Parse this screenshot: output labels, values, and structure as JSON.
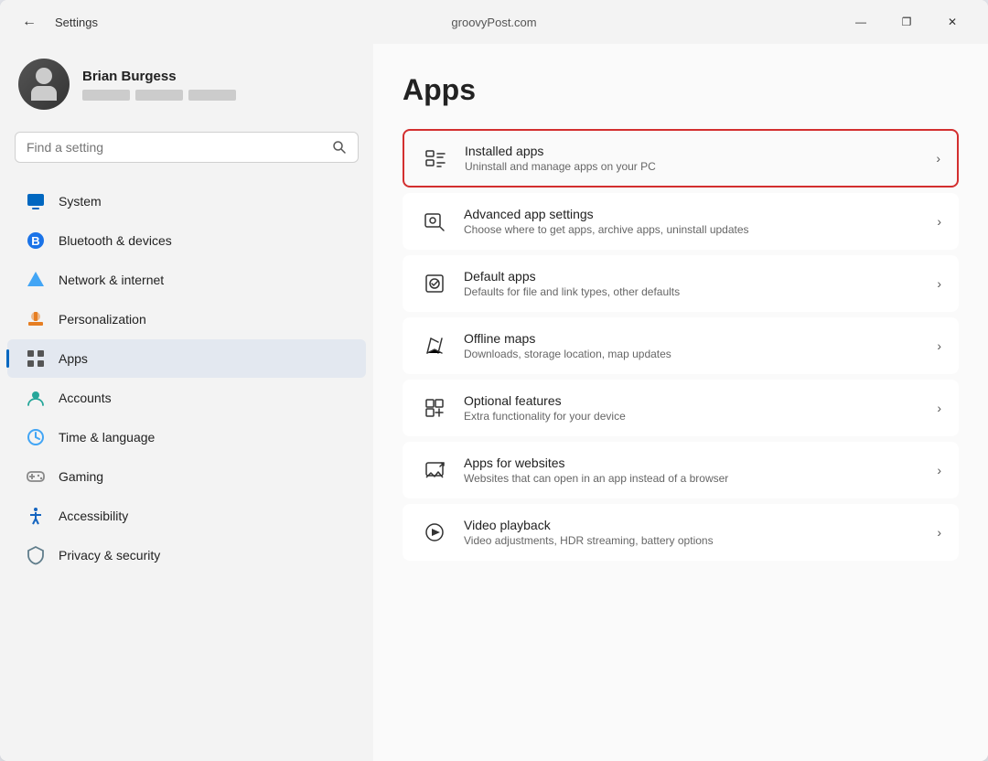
{
  "titleBar": {
    "back": "←",
    "title": "Settings",
    "watermark": "groovyPost.com",
    "controls": {
      "minimize": "—",
      "maximize": "❐",
      "close": "✕"
    }
  },
  "user": {
    "name": "Brian Burgess"
  },
  "search": {
    "placeholder": "Find a setting"
  },
  "nav": {
    "items": [
      {
        "id": "system",
        "label": "System",
        "icon": "system"
      },
      {
        "id": "bluetooth",
        "label": "Bluetooth & devices",
        "icon": "bluetooth"
      },
      {
        "id": "network",
        "label": "Network & internet",
        "icon": "network"
      },
      {
        "id": "personalization",
        "label": "Personalization",
        "icon": "personalization"
      },
      {
        "id": "apps",
        "label": "Apps",
        "icon": "apps",
        "active": true
      },
      {
        "id": "accounts",
        "label": "Accounts",
        "icon": "accounts"
      },
      {
        "id": "time",
        "label": "Time & language",
        "icon": "time"
      },
      {
        "id": "gaming",
        "label": "Gaming",
        "icon": "gaming"
      },
      {
        "id": "accessibility",
        "label": "Accessibility",
        "icon": "accessibility"
      },
      {
        "id": "privacy",
        "label": "Privacy & security",
        "icon": "privacy"
      }
    ]
  },
  "rightPanel": {
    "title": "Apps",
    "items": [
      {
        "id": "installed",
        "title": "Installed apps",
        "desc": "Uninstall and manage apps on your PC",
        "highlighted": true
      },
      {
        "id": "advanced",
        "title": "Advanced app settings",
        "desc": "Choose where to get apps, archive apps, uninstall updates",
        "highlighted": false
      },
      {
        "id": "default",
        "title": "Default apps",
        "desc": "Defaults for file and link types, other defaults",
        "highlighted": false
      },
      {
        "id": "offline-maps",
        "title": "Offline maps",
        "desc": "Downloads, storage location, map updates",
        "highlighted": false
      },
      {
        "id": "optional",
        "title": "Optional features",
        "desc": "Extra functionality for your device",
        "highlighted": false
      },
      {
        "id": "websites",
        "title": "Apps for websites",
        "desc": "Websites that can open in an app instead of a browser",
        "highlighted": false
      },
      {
        "id": "video",
        "title": "Video playback",
        "desc": "Video adjustments, HDR streaming, battery options",
        "highlighted": false
      }
    ]
  }
}
